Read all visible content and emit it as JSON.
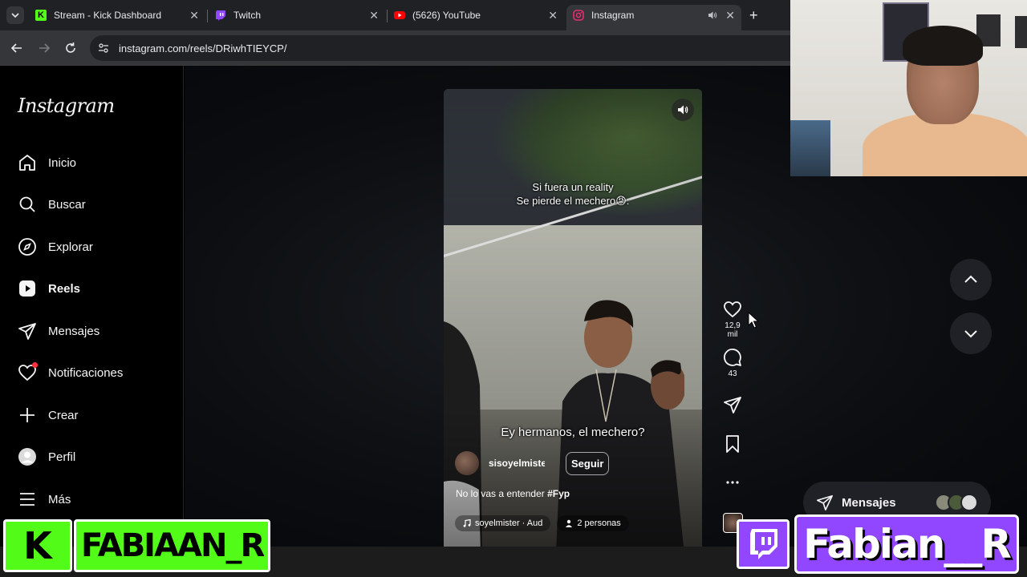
{
  "browser": {
    "tabs": [
      {
        "title": "Stream - Kick Dashboard",
        "favicon_color": "#53fc18",
        "favicon_letter": "K"
      },
      {
        "title": "Twitch",
        "favicon_color": "#9146ff",
        "favicon_letter": ""
      },
      {
        "title": "(5626) YouTube",
        "favicon_color": "#ff0000",
        "favicon_letter": ""
      },
      {
        "title": "Instagram",
        "favicon_color": "#e1306c",
        "favicon_letter": "",
        "active": true
      }
    ],
    "url": "instagram.com/reels/DRiwhTIEYCP/"
  },
  "instagram": {
    "logo": "Instagram",
    "nav": [
      {
        "label": "Inicio",
        "icon": "home-icon"
      },
      {
        "label": "Buscar",
        "icon": "search-icon"
      },
      {
        "label": "Explorar",
        "icon": "compass-icon"
      },
      {
        "label": "Reels",
        "icon": "reels-icon",
        "active": true
      },
      {
        "label": "Mensajes",
        "icon": "direct-icon"
      },
      {
        "label": "Notificaciones",
        "icon": "heart-icon"
      },
      {
        "label": "Crear",
        "icon": "plus-icon"
      },
      {
        "label": "Perfil",
        "icon": "profile-icon"
      },
      {
        "label": "Más",
        "icon": "menu-icon"
      }
    ],
    "reel": {
      "overlay_text_line1": "Si fuera un reality",
      "overlay_text_line2": "Se pierde el mechero😡:",
      "subtitle": "Ey hermanos, el mechero?",
      "author": "sisoyelmister",
      "follow_label": "Seguir",
      "caption": "No lo vas a entender",
      "hashtag": "#Fyp",
      "audio": "soyelmister · Aud",
      "people": "2 personas",
      "likes": "12,9 mil",
      "comments": "43"
    },
    "messages_label": "Mensajes"
  },
  "overlays": {
    "kick_name": "FABIAAN_R",
    "twitch_name": "Fabian__R"
  },
  "colors": {
    "kick_green": "#53fc18",
    "twitch_purple": "#9146ff",
    "notification_red": "#ff3040"
  }
}
